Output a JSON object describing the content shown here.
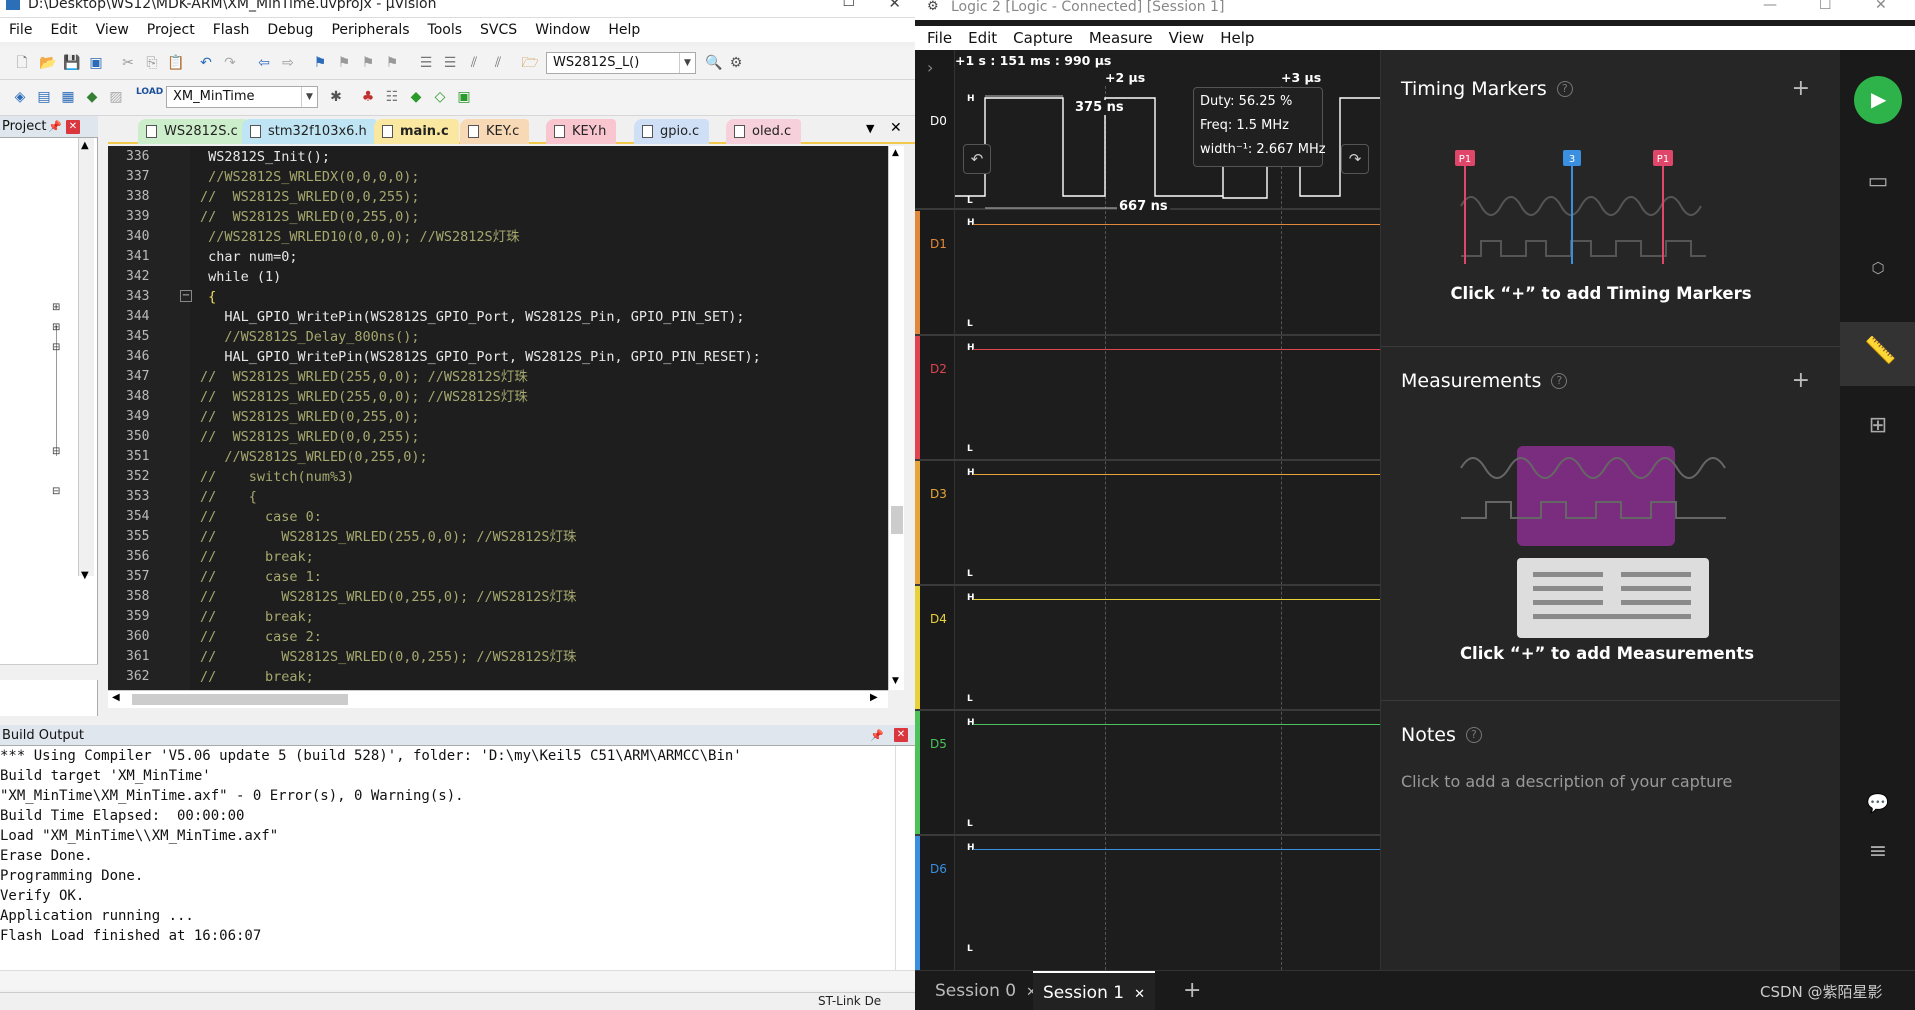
{
  "uvision": {
    "title": "D:\\Desktop\\WS12\\MDK-ARM\\XM_MinTime.uvprojx - µVision",
    "menu": [
      "File",
      "Edit",
      "View",
      "Project",
      "Flash",
      "Debug",
      "Peripherals",
      "Tools",
      "SVCS",
      "Window",
      "Help"
    ],
    "toolbar": {
      "search_combo": "WS2812S_L()",
      "target_combo": "XM_MinTime",
      "load_label": "LOAD"
    },
    "project_pane": {
      "title": "Project"
    },
    "tabs": [
      {
        "label": "WS2812S.c",
        "color": "#cdeecb"
      },
      {
        "label": "stm32f103x6.h",
        "color": "#bfe4f3"
      },
      {
        "label": "main.c",
        "color": "#fbe8a0",
        "active": true
      },
      {
        "label": "KEY.c",
        "color": "#f8d9b5"
      },
      {
        "label": "KEY.h",
        "color": "#f9c5cf"
      },
      {
        "label": "gpio.c",
        "color": "#cfe0f6"
      },
      {
        "label": "oled.c",
        "color": "#f6d0da"
      }
    ],
    "code_lines": [
      {
        "n": "336",
        "text": " WS2812S_Init();",
        "c": "#e8e8e8"
      },
      {
        "n": "337",
        "text": " //WS2812S_WRLEDX(0,0,0,0);",
        "c": "#a6a86e"
      },
      {
        "n": "338",
        "text": "//  WS2812S_WRLED(0,0,255);",
        "c": "#a6a86e"
      },
      {
        "n": "339",
        "text": "//  WS2812S_WRLED(0,255,0);",
        "c": "#a6a86e"
      },
      {
        "n": "340",
        "text": " //WS2812S_WRLED10(0,0,0); //WS2812S灯珠",
        "c": "#a6a86e"
      },
      {
        "n": "341",
        "text": " char num=0;",
        "c": "#e8e8e8"
      },
      {
        "n": "342",
        "text": " while (1)",
        "c": "#e8e8e8"
      },
      {
        "n": "343",
        "text": " {",
        "c": "#f0e060"
      },
      {
        "n": "344",
        "text": "   HAL_GPIO_WritePin(WS2812S_GPIO_Port, WS2812S_Pin, GPIO_PIN_SET);",
        "c": "#e8e8e8"
      },
      {
        "n": "345",
        "text": "   //WS2812S_Delay_800ns();",
        "c": "#a6a86e"
      },
      {
        "n": "346",
        "text": "   HAL_GPIO_WritePin(WS2812S_GPIO_Port, WS2812S_Pin, GPIO_PIN_RESET);",
        "c": "#e8e8e8"
      },
      {
        "n": "347",
        "text": "//  WS2812S_WRLED(255,0,0); //WS2812S灯珠",
        "c": "#a6a86e"
      },
      {
        "n": "348",
        "text": "//  WS2812S_WRLED(255,0,0); //WS2812S灯珠",
        "c": "#a6a86e"
      },
      {
        "n": "349",
        "text": "//  WS2812S_WRLED(0,255,0);",
        "c": "#a6a86e"
      },
      {
        "n": "350",
        "text": "//  WS2812S_WRLED(0,0,255);",
        "c": "#a6a86e"
      },
      {
        "n": "351",
        "text": "   //WS2812S_WRLED(0,255,0);",
        "c": "#a6a86e"
      },
      {
        "n": "352",
        "text": "//    switch(num%3)",
        "c": "#a6a86e"
      },
      {
        "n": "353",
        "text": "//    {",
        "c": "#a6a86e"
      },
      {
        "n": "354",
        "text": "//      case 0:",
        "c": "#a6a86e"
      },
      {
        "n": "355",
        "text": "//        WS2812S_WRLED(255,0,0); //WS2812S灯珠",
        "c": "#a6a86e"
      },
      {
        "n": "356",
        "text": "//      break;",
        "c": "#a6a86e"
      },
      {
        "n": "357",
        "text": "//      case 1:",
        "c": "#a6a86e"
      },
      {
        "n": "358",
        "text": "//        WS2812S_WRLED(0,255,0); //WS2812S灯珠",
        "c": "#a6a86e"
      },
      {
        "n": "359",
        "text": "//      break;",
        "c": "#a6a86e"
      },
      {
        "n": "360",
        "text": "//      case 2:",
        "c": "#a6a86e"
      },
      {
        "n": "361",
        "text": "//        WS2812S_WRLED(0,0,255); //WS2812S灯珠",
        "c": "#a6a86e"
      },
      {
        "n": "362",
        "text": "//      break;",
        "c": "#a6a86e"
      }
    ],
    "build_output": {
      "title": "Build Output",
      "lines": [
        "*** Using Compiler 'V5.06 update 5 (build 528)', folder: 'D:\\my\\Keil5 C51\\ARM\\ARMCC\\Bin'",
        "Build target 'XM_MinTime'",
        "\"XM_MinTime\\XM_MinTime.axf\" - 0 Error(s), 0 Warning(s).",
        "Build Time Elapsed:  00:00:00",
        "Load \"XM_MinTime\\\\XM_MinTime.axf\"",
        "Erase Done.",
        "Programming Done.",
        "Verify OK.",
        "Application running ...",
        "Flash Load finished at 16:06:07"
      ]
    },
    "status": "ST-Link De"
  },
  "logic": {
    "title": "Logic 2 [Logic - Connected] [Session 1]",
    "menu": [
      "File",
      "Edit",
      "Capture",
      "Measure",
      "View",
      "Help"
    ],
    "timeline": {
      "origin": "+1 s : 151 ms : 990 µs",
      "t2": "+2 µs",
      "t3": "+3 µs"
    },
    "measure": {
      "high": "375 ns",
      "period": "667 ns",
      "duty": "Duty: 56.25 %",
      "freq": "Freq: 1.5 MHz",
      "width": "width⁻¹: 2.667 MHz"
    },
    "channels": [
      {
        "label": "D0",
        "color": "#ffffff"
      },
      {
        "label": "D1",
        "color": "#e0893a"
      },
      {
        "label": "D2",
        "color": "#e04550"
      },
      {
        "label": "D3",
        "color": "#e8a63a"
      },
      {
        "label": "D4",
        "color": "#e8d23a"
      },
      {
        "label": "D5",
        "color": "#4cc35a"
      },
      {
        "label": "D6",
        "color": "#3a8fe0"
      }
    ],
    "hl": {
      "h": "H",
      "l": "L"
    },
    "timing": {
      "title": "Timing Markers",
      "hint": "Click “+” to add Timing Markers",
      "p1": "P1",
      "m3": "3"
    },
    "measurements": {
      "title": "Measurements",
      "hint": "Click “+” to add Measurements"
    },
    "notes": {
      "title": "Notes",
      "placeholder": "Click to add a description of your capture"
    },
    "sessions": [
      {
        "label": "Session 0",
        "active": false
      },
      {
        "label": "Session 1",
        "active": true
      }
    ],
    "watermark": "CSDN @紫陌星影"
  }
}
